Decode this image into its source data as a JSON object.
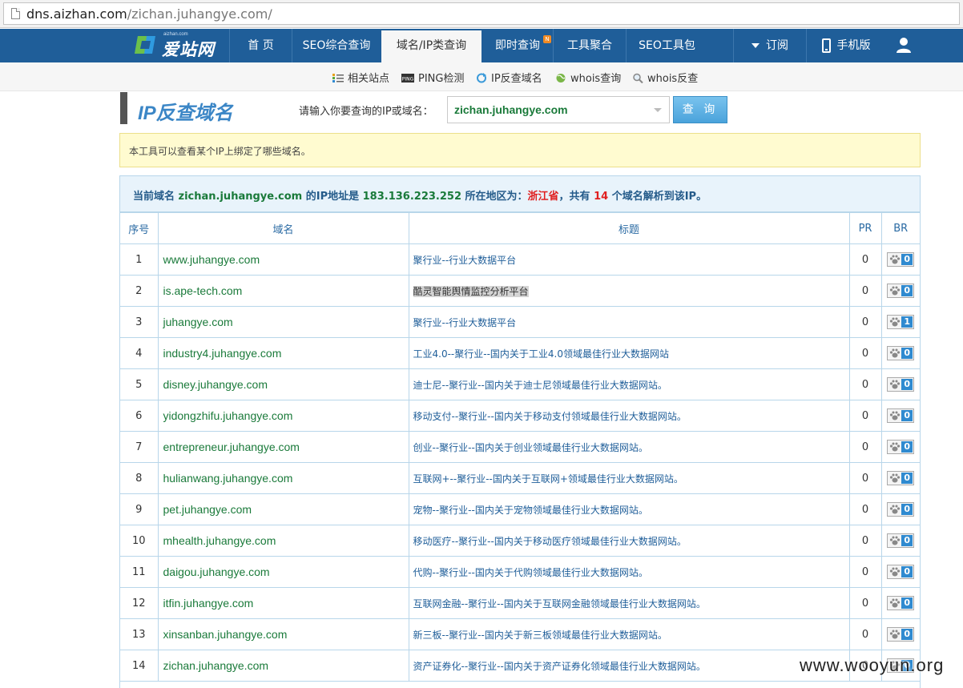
{
  "browser": {
    "url_host": "dns.aizhan.com",
    "url_path": "/zichan.juhangye.com/"
  },
  "logo": {
    "sub": "aizhan.com",
    "text": "爱站网"
  },
  "nav": {
    "items": [
      "首 页",
      "SEO综合查询",
      "域名/IP类查询",
      "即时查询",
      "工具聚合",
      "SEO工具包"
    ],
    "new_badge": "N",
    "subscribe": "订阅",
    "mobile": "手机版"
  },
  "subnav": {
    "items": [
      "相关站点",
      "PING检测",
      "IP反查域名",
      "whois查询",
      "whois反查"
    ]
  },
  "search": {
    "title": "IP反查域名",
    "prompt": "请输入你要查询的IP或域名：",
    "value": "zichan.juhangye.com",
    "button": "查 询"
  },
  "notice": "本工具可以查看某个IP上绑定了哪些域名。",
  "summary": {
    "p1": "当前域名 ",
    "domain": "zichan.juhangye.com",
    "p2": " 的IP地址是 ",
    "ip": "183.136.223.252",
    "p3": " 所在地区为：",
    "region": "浙江省",
    "p4": "，共有 ",
    "count": "14",
    "p5": " 个域名解析到该IP。"
  },
  "table": {
    "headers": [
      "序号",
      "域名",
      "标题",
      "PR",
      "BR"
    ],
    "rows": [
      {
        "n": "1",
        "domain": "www.juhangye.com",
        "title": "聚行业--行业大数据平台",
        "pr": "0",
        "br": "0"
      },
      {
        "n": "2",
        "domain": "is.ape-tech.com",
        "title": "酷灵智能舆情监控分析平台",
        "pr": "0",
        "br": "0",
        "highlight": true
      },
      {
        "n": "3",
        "domain": "juhangye.com",
        "title": "聚行业--行业大数据平台",
        "pr": "0",
        "br": "1"
      },
      {
        "n": "4",
        "domain": "industry4.juhangye.com",
        "title": "工业4.0--聚行业--国内关于工业4.0领域最佳行业大数据网站",
        "pr": "0",
        "br": "0"
      },
      {
        "n": "5",
        "domain": "disney.juhangye.com",
        "title": "迪士尼--聚行业--国内关于迪士尼领域最佳行业大数据网站。",
        "pr": "0",
        "br": "0"
      },
      {
        "n": "6",
        "domain": "yidongzhifu.juhangye.com",
        "title": "移动支付--聚行业--国内关于移动支付领域最佳行业大数据网站。",
        "pr": "0",
        "br": "0"
      },
      {
        "n": "7",
        "domain": "entrepreneur.juhangye.com",
        "title": "创业--聚行业--国内关于创业领域最佳行业大数据网站。",
        "pr": "0",
        "br": "0"
      },
      {
        "n": "8",
        "domain": "hulianwang.juhangye.com",
        "title": "互联网+--聚行业--国内关于互联网+领域最佳行业大数据网站。",
        "pr": "0",
        "br": "0"
      },
      {
        "n": "9",
        "domain": "pet.juhangye.com",
        "title": "宠物--聚行业--国内关于宠物领域最佳行业大数据网站。",
        "pr": "0",
        "br": "0"
      },
      {
        "n": "10",
        "domain": "mhealth.juhangye.com",
        "title": "移动医疗--聚行业--国内关于移动医疗领域最佳行业大数据网站。",
        "pr": "0",
        "br": "0"
      },
      {
        "n": "11",
        "domain": "daigou.juhangye.com",
        "title": "代购--聚行业--国内关于代购领域最佳行业大数据网站。",
        "pr": "0",
        "br": "0"
      },
      {
        "n": "12",
        "domain": "itfin.juhangye.com",
        "title": "互联网金融--聚行业--国内关于互联网金融领域最佳行业大数据网站。",
        "pr": "0",
        "br": "0"
      },
      {
        "n": "13",
        "domain": "xinsanban.juhangye.com",
        "title": "新三板--聚行业--国内关于新三板领域最佳行业大数据网站。",
        "pr": "0",
        "br": "0"
      },
      {
        "n": "14",
        "domain": "zichan.juhangye.com",
        "title": "资产证券化--聚行业--国内关于资产证券化领域最佳行业大数据网站。",
        "pr": "0",
        "br": "0"
      }
    ]
  },
  "watermark": "www.wooyun.org"
}
